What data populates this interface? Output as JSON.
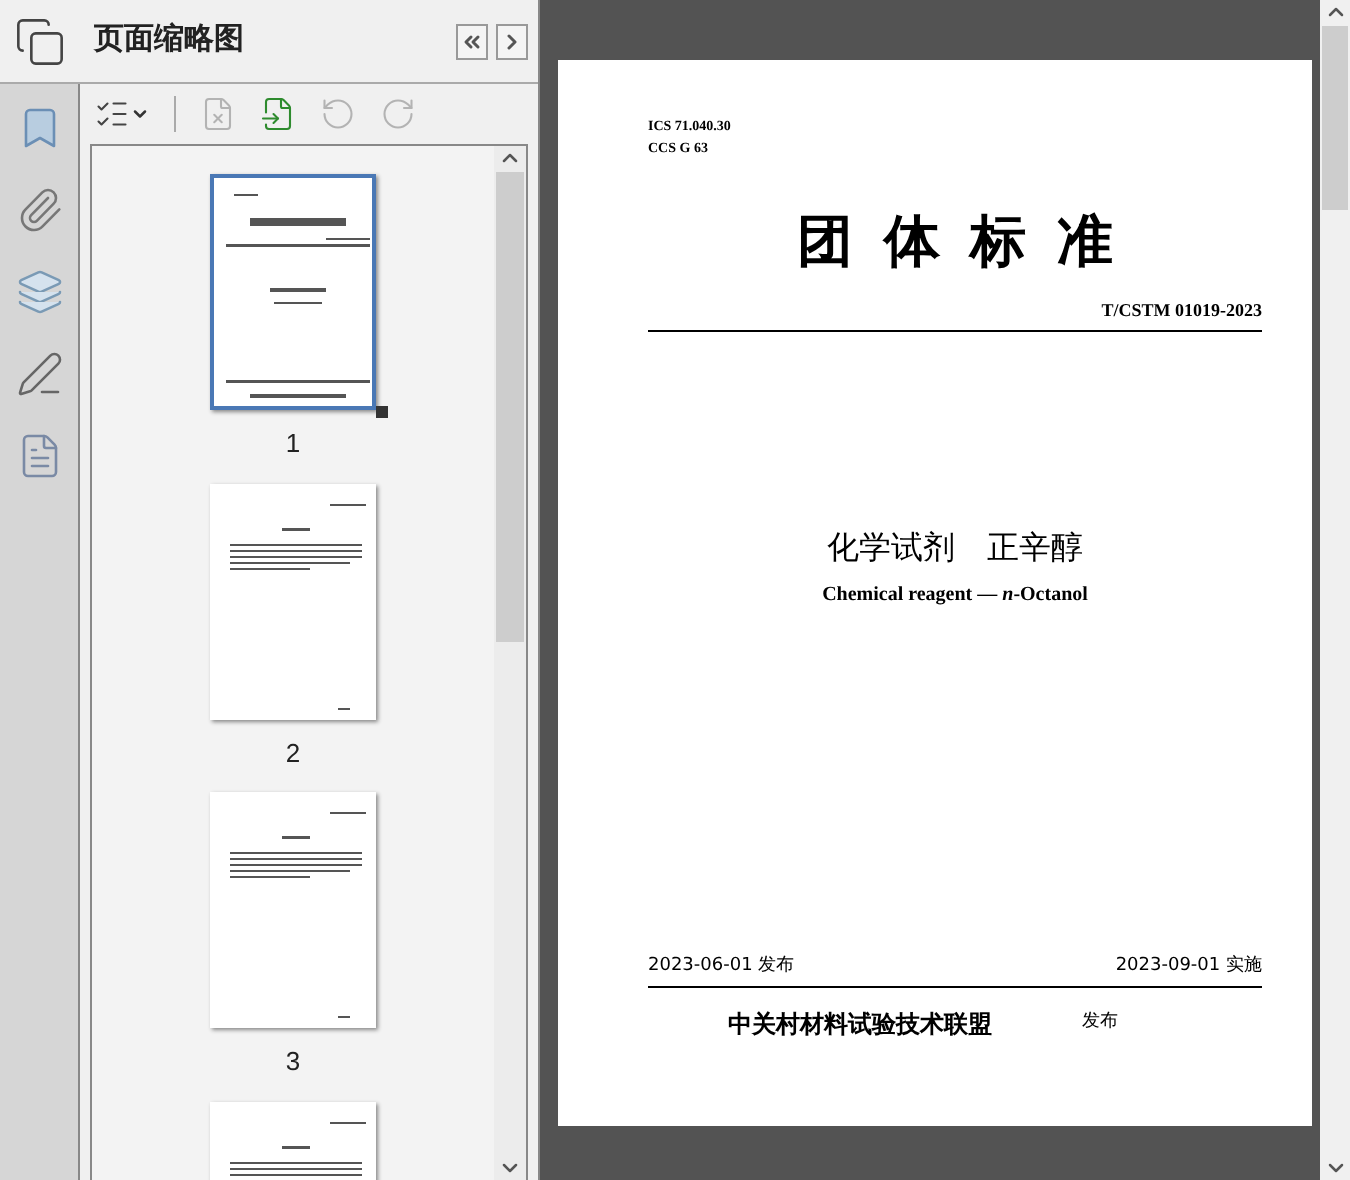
{
  "panel": {
    "title": "页面缩略图"
  },
  "toolbar": [
    {
      "kind": "options",
      "disabled": false
    },
    {
      "kind": "delete",
      "disabled": true
    },
    {
      "kind": "insert",
      "disabled": false
    },
    {
      "kind": "undo",
      "disabled": true
    },
    {
      "kind": "redo",
      "disabled": true
    }
  ],
  "pages": [
    {
      "label": "1",
      "selected": true,
      "kind": "cover"
    },
    {
      "label": "2",
      "selected": false,
      "kind": "text"
    },
    {
      "label": "3",
      "selected": false,
      "kind": "text"
    },
    {
      "selected": false,
      "kind": "text"
    }
  ],
  "document": {
    "ics": "ICS 71.040.30",
    "ccs": "CCS G 63",
    "heading": "团体标准",
    "code": "T/CSTM 01019-2023",
    "title_zh": "化学试剂　正辛醇",
    "title_en": "Chemical reagent — *n*-Octanol",
    "publish_date": "2023-06-01 发布",
    "effective_date": "2023-09-01 实施",
    "publisher": "中关村材料试验技术联盟",
    "publish_label": "发布"
  }
}
